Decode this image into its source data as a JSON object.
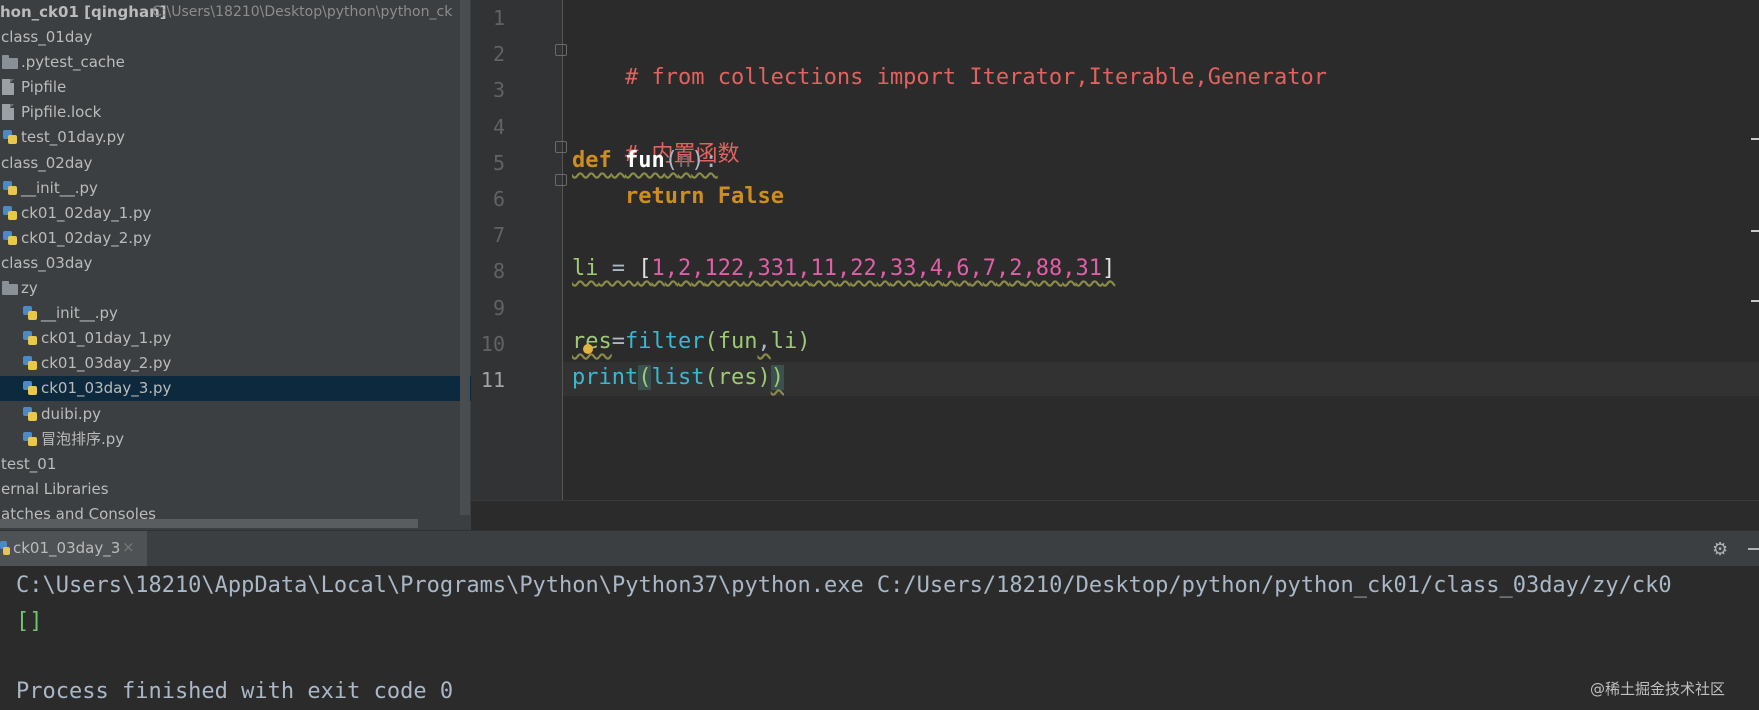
{
  "project": {
    "header_name": "hon_ck01 [qinghan]",
    "header_path": "C:\\Users\\18210\\Desktop\\python\\python_ck",
    "items": [
      {
        "label": "class_01day",
        "icon": "folder-icon",
        "depth": 0
      },
      {
        "label": ".pytest_cache",
        "icon": "folder-icon",
        "depth": 1
      },
      {
        "label": "Pipfile",
        "icon": "file-icon",
        "depth": 1
      },
      {
        "label": "Pipfile.lock",
        "icon": "file-icon",
        "depth": 1
      },
      {
        "label": "test_01day.py",
        "icon": "python-file-icon",
        "depth": 1
      },
      {
        "label": "class_02day",
        "icon": "folder-icon",
        "depth": 0
      },
      {
        "label": "__init__.py",
        "icon": "python-file-icon",
        "depth": 1
      },
      {
        "label": "ck01_02day_1.py",
        "icon": "python-file-icon",
        "depth": 1
      },
      {
        "label": "ck01_02day_2.py",
        "icon": "python-file-icon",
        "depth": 1
      },
      {
        "label": "class_03day",
        "icon": "folder-icon",
        "depth": 0
      },
      {
        "label": "zy",
        "icon": "folder-icon",
        "depth": 1
      },
      {
        "label": "__init__.py",
        "icon": "python-file-icon",
        "depth": 2
      },
      {
        "label": "ck01_01day_1.py",
        "icon": "python-file-icon",
        "depth": 2
      },
      {
        "label": "ck01_03day_2.py",
        "icon": "python-file-icon",
        "depth": 2
      },
      {
        "label": "ck01_03day_3.py",
        "icon": "python-file-icon",
        "depth": 2,
        "selected": true
      },
      {
        "label": "duibi.py",
        "icon": "python-file-icon",
        "depth": 2
      },
      {
        "label": "冒泡排序.py",
        "icon": "python-file-icon",
        "depth": 2
      },
      {
        "label": "test_01",
        "icon": "folder-icon",
        "depth": 0
      },
      {
        "label": "ernal Libraries",
        "icon": "library-icon",
        "depth": 0
      },
      {
        "label": "atches and Consoles",
        "icon": "scratch-icon",
        "depth": 0
      }
    ]
  },
  "editor": {
    "line_numbers": [
      "1",
      "2",
      "3",
      "4",
      "5",
      "6",
      "7",
      "8",
      "9",
      "10",
      "11"
    ],
    "current_line": "11",
    "code": {
      "l2": "# from collections import Iterator,Iterable,Generator",
      "l4": "# 内置函数",
      "l5_def": "def",
      "l5_name": "fun",
      "l5_param": "n",
      "l6_return": "return",
      "l6_value": "False",
      "l8_var": "li",
      "l8_numbers": [
        "1",
        "2",
        "122",
        "331",
        "11",
        "22",
        "33",
        "4",
        "6",
        "7",
        "2",
        "88",
        "31"
      ],
      "l10_var": "res",
      "l10_call": "filter",
      "l10_arg1": "fun",
      "l10_arg2": "li",
      "l11_print": "print",
      "l11_list": "list",
      "l11_arg": "res"
    }
  },
  "run": {
    "tab_label": "ck01_03day_3",
    "tab_close": "×",
    "command": "C:\\Users\\18210\\AppData\\Local\\Programs\\Python\\Python37\\python.exe C:/Users/18210/Desktop/python/python_ck01/class_03day/zy/ck0",
    "result": "[]",
    "exit_message": "Process finished with exit code 0"
  },
  "watermark": "@稀土掘金技术社区",
  "colors": {
    "comment": "#e1625e",
    "keyword": "#cc8f1f",
    "number": "#e05fa7",
    "builtin": "#39b8d1",
    "variable": "#9ec978",
    "selection": "#0d293e"
  }
}
